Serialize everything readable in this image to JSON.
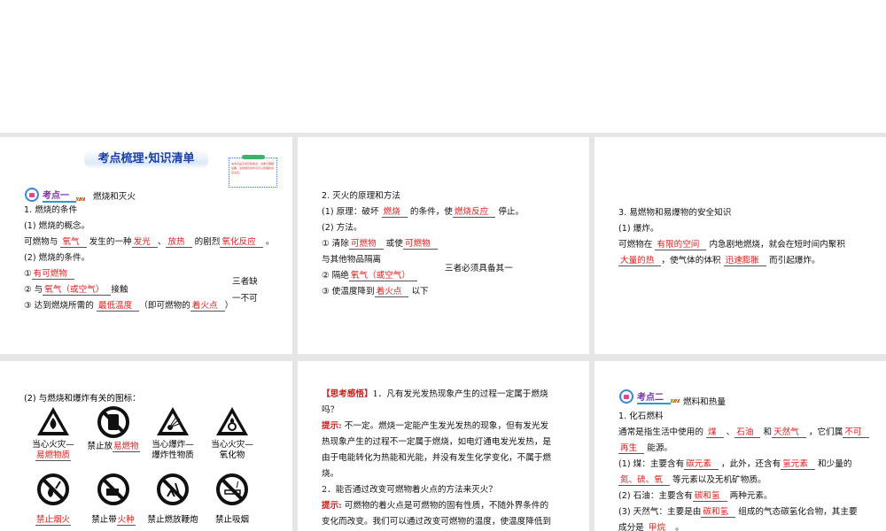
{
  "slides": [
    {
      "title": "考点梳理·知识清单",
      "note": "本考点是高考高频考点，请重点理解掌握，注意燃烧条件与灭火原理的对应关系。",
      "badge": "考点一",
      "topic": "燃烧和灭火",
      "side": [
        "三者缺",
        "一不可"
      ],
      "lines": [
        [
          {
            "t": "1. 燃烧的条件"
          }
        ],
        [
          {
            "t": "(1) 燃烧的概念。"
          }
        ],
        [
          {
            "t": "可燃物与 "
          },
          {
            "t": "氧气",
            "k": "ans"
          },
          {
            "t": " 发生的一种"
          },
          {
            "t": "发光",
            "k": "ans"
          },
          {
            "t": "、"
          },
          {
            "t": "放热",
            "k": "ans"
          },
          {
            "t": " 的剧烈"
          },
          {
            "t": "氧化反应",
            "k": "ans"
          },
          {
            "t": " 。"
          }
        ],
        [
          {
            "t": "(2) 燃烧的条件。"
          }
        ],
        [
          {
            "t": "①"
          },
          {
            "t": "有可燃物",
            "k": "ans"
          }
        ],
        [
          {
            "t": "② 与"
          },
          {
            "t": "氧气（或空气）",
            "k": "ans"
          },
          {
            "t": "接触"
          }
        ],
        [
          {
            "t": "③ 达到燃烧所需的 "
          },
          {
            "t": "最低温度",
            "k": "ans"
          },
          {
            "t": "（即可燃物的"
          },
          {
            "t": "着火点",
            "k": "ans"
          },
          {
            "t": "）"
          }
        ]
      ]
    },
    {
      "side": [
        "三者必须具备其一"
      ],
      "lines": [
        [
          {
            "t": "2. 灭火的原理和方法"
          }
        ],
        [
          {
            "t": "(1) 原理：破坏 "
          },
          {
            "t": "燃烧",
            "k": "ans"
          },
          {
            "t": " 的条件，使"
          },
          {
            "t": "燃烧反应",
            "k": "ans"
          },
          {
            "t": " 停止。"
          }
        ],
        [
          {
            "t": "(2) 方法。"
          }
        ],
        [
          {
            "t": "① 清除"
          },
          {
            "t": "可燃物",
            "k": "ans"
          },
          {
            "t": " 或使"
          },
          {
            "t": "可燃物",
            "k": "ans"
          }
        ],
        [
          {
            "t": "与其他物品隔离"
          }
        ],
        [
          {
            "t": "② 隔绝"
          },
          {
            "t": "氧气（或空气）",
            "k": "ans"
          }
        ],
        [
          {
            "t": "③ 使温度降到"
          },
          {
            "t": "着火点",
            "k": "ans"
          },
          {
            "t": " 以下"
          }
        ]
      ]
    },
    {
      "lines": [
        [
          {
            "t": "3. 易燃物和易爆物的安全知识"
          }
        ],
        [
          {
            "t": "(1) 爆炸。"
          }
        ],
        [
          {
            "t": "可燃物在 "
          },
          {
            "t": "有限的空间",
            "k": "ans"
          },
          {
            "t": " 内急剧地燃烧，就会在短时间内聚积"
          }
        ],
        [
          {
            "t": "大量的热",
            "k": "ans"
          },
          {
            "t": "，使气体的体积 "
          },
          {
            "t": "迅速膨胀",
            "k": "ans"
          },
          {
            "t": " 而引起爆炸。"
          }
        ]
      ]
    },
    {
      "heading": "(2) 与燃烧和爆炸有关的图标：",
      "icons": [
        {
          "icon": "warning-flammable",
          "label": [
            {
              "t": "当心火灾—"
            },
            {
              "t": "易燃物质",
              "k": "ans"
            }
          ]
        },
        {
          "icon": "no-flammables",
          "label": [
            {
              "t": "禁止放"
            },
            {
              "t": "易燃物",
              "k": "ans"
            }
          ]
        },
        {
          "icon": "warning-explosive",
          "label": [
            {
              "t": "当心爆炸—"
            },
            {
              "t": "爆炸性物质"
            }
          ]
        },
        {
          "icon": "warning-oxidizer",
          "label": [
            {
              "t": "当心火灾—"
            },
            {
              "t": "氧化物"
            }
          ]
        },
        {
          "icon": "no-open-flame",
          "label": [
            {
              "t": "禁止烟火",
              "k": "ans"
            }
          ]
        },
        {
          "icon": "no-matches",
          "label": [
            {
              "t": "禁止带"
            },
            {
              "t": "火种",
              "k": "ans"
            }
          ]
        },
        {
          "icon": "no-fireworks",
          "label": [
            {
              "t": "禁止燃放鞭炮"
            }
          ]
        },
        {
          "icon": "no-smoking",
          "label": [
            {
              "t": "禁止吸烟"
            }
          ]
        }
      ]
    },
    {
      "lines": [
        [
          {
            "t": "【思考感悟】",
            "k": "red"
          },
          {
            "t": "1．凡有发光发热现象产生的过程一定属于燃烧"
          }
        ],
        [
          {
            "t": "吗？"
          }
        ],
        [
          {
            "t": "提示:",
            "k": "red"
          },
          {
            "t": " 不一定。燃烧一定能产生发光发热的现象，但有发光发"
          }
        ],
        [
          {
            "t": "热现象产生的过程不一定属于燃烧，如电灯通电发光发热，是"
          }
        ],
        [
          {
            "t": "由于电能转化为热能和光能，并没有发生化学变化，不属于燃"
          }
        ],
        [
          {
            "t": "烧。"
          }
        ],
        [
          {
            "t": "2．能否通过改变可燃物着火点的方法来灭火？"
          }
        ],
        [
          {
            "t": "提示:",
            "k": "red"
          },
          {
            "t": " 可燃物的着火点是可燃物的固有性质，不随外界条件的"
          }
        ],
        [
          {
            "t": "变化而改变。我们可以通过改变可燃物的温度，使温度降低到"
          }
        ]
      ]
    },
    {
      "badge": "考点二",
      "topic": "燃料和热量",
      "lines": [
        [
          {
            "t": "1. 化石燃料"
          }
        ],
        [
          {
            "t": "通常是指生活中使用的 "
          },
          {
            "t": "煤",
            "k": "ans"
          },
          {
            "t": " 、"
          },
          {
            "t": "石油",
            "k": "ans"
          },
          {
            "t": " 和"
          },
          {
            "t": "天然气",
            "k": "ans"
          },
          {
            "t": " ，它们属"
          },
          {
            "t": "不可",
            "k": "ans"
          }
        ],
        [
          {
            "t": "再生",
            "k": "ans"
          },
          {
            "t": " 能源。"
          }
        ],
        [
          {
            "t": "(1) 煤：主要含有"
          },
          {
            "t": "碳元素",
            "k": "ans"
          },
          {
            "t": " ，此外，还含有"
          },
          {
            "t": "氢元素",
            "k": "ans"
          },
          {
            "t": " 和少量的"
          }
        ],
        [
          {
            "t": "氮、硫、氧",
            "k": "ans"
          },
          {
            "t": " 等元素以及无机矿物质。"
          }
        ],
        [
          {
            "t": "(2) 石油：主要含有"
          },
          {
            "t": "碳和氢",
            "k": "ans"
          },
          {
            "t": " 两种元素。"
          }
        ],
        [
          {
            "t": "(3) 天然气：主要是由"
          },
          {
            "t": "碳和氢",
            "k": "ans"
          },
          {
            "t": " 组成的气态碳氢化合物，其主要"
          }
        ],
        [
          {
            "t": "成分是 "
          },
          {
            "t": "甲烷",
            "k": "ans"
          },
          {
            "t": " 。"
          }
        ]
      ]
    }
  ]
}
